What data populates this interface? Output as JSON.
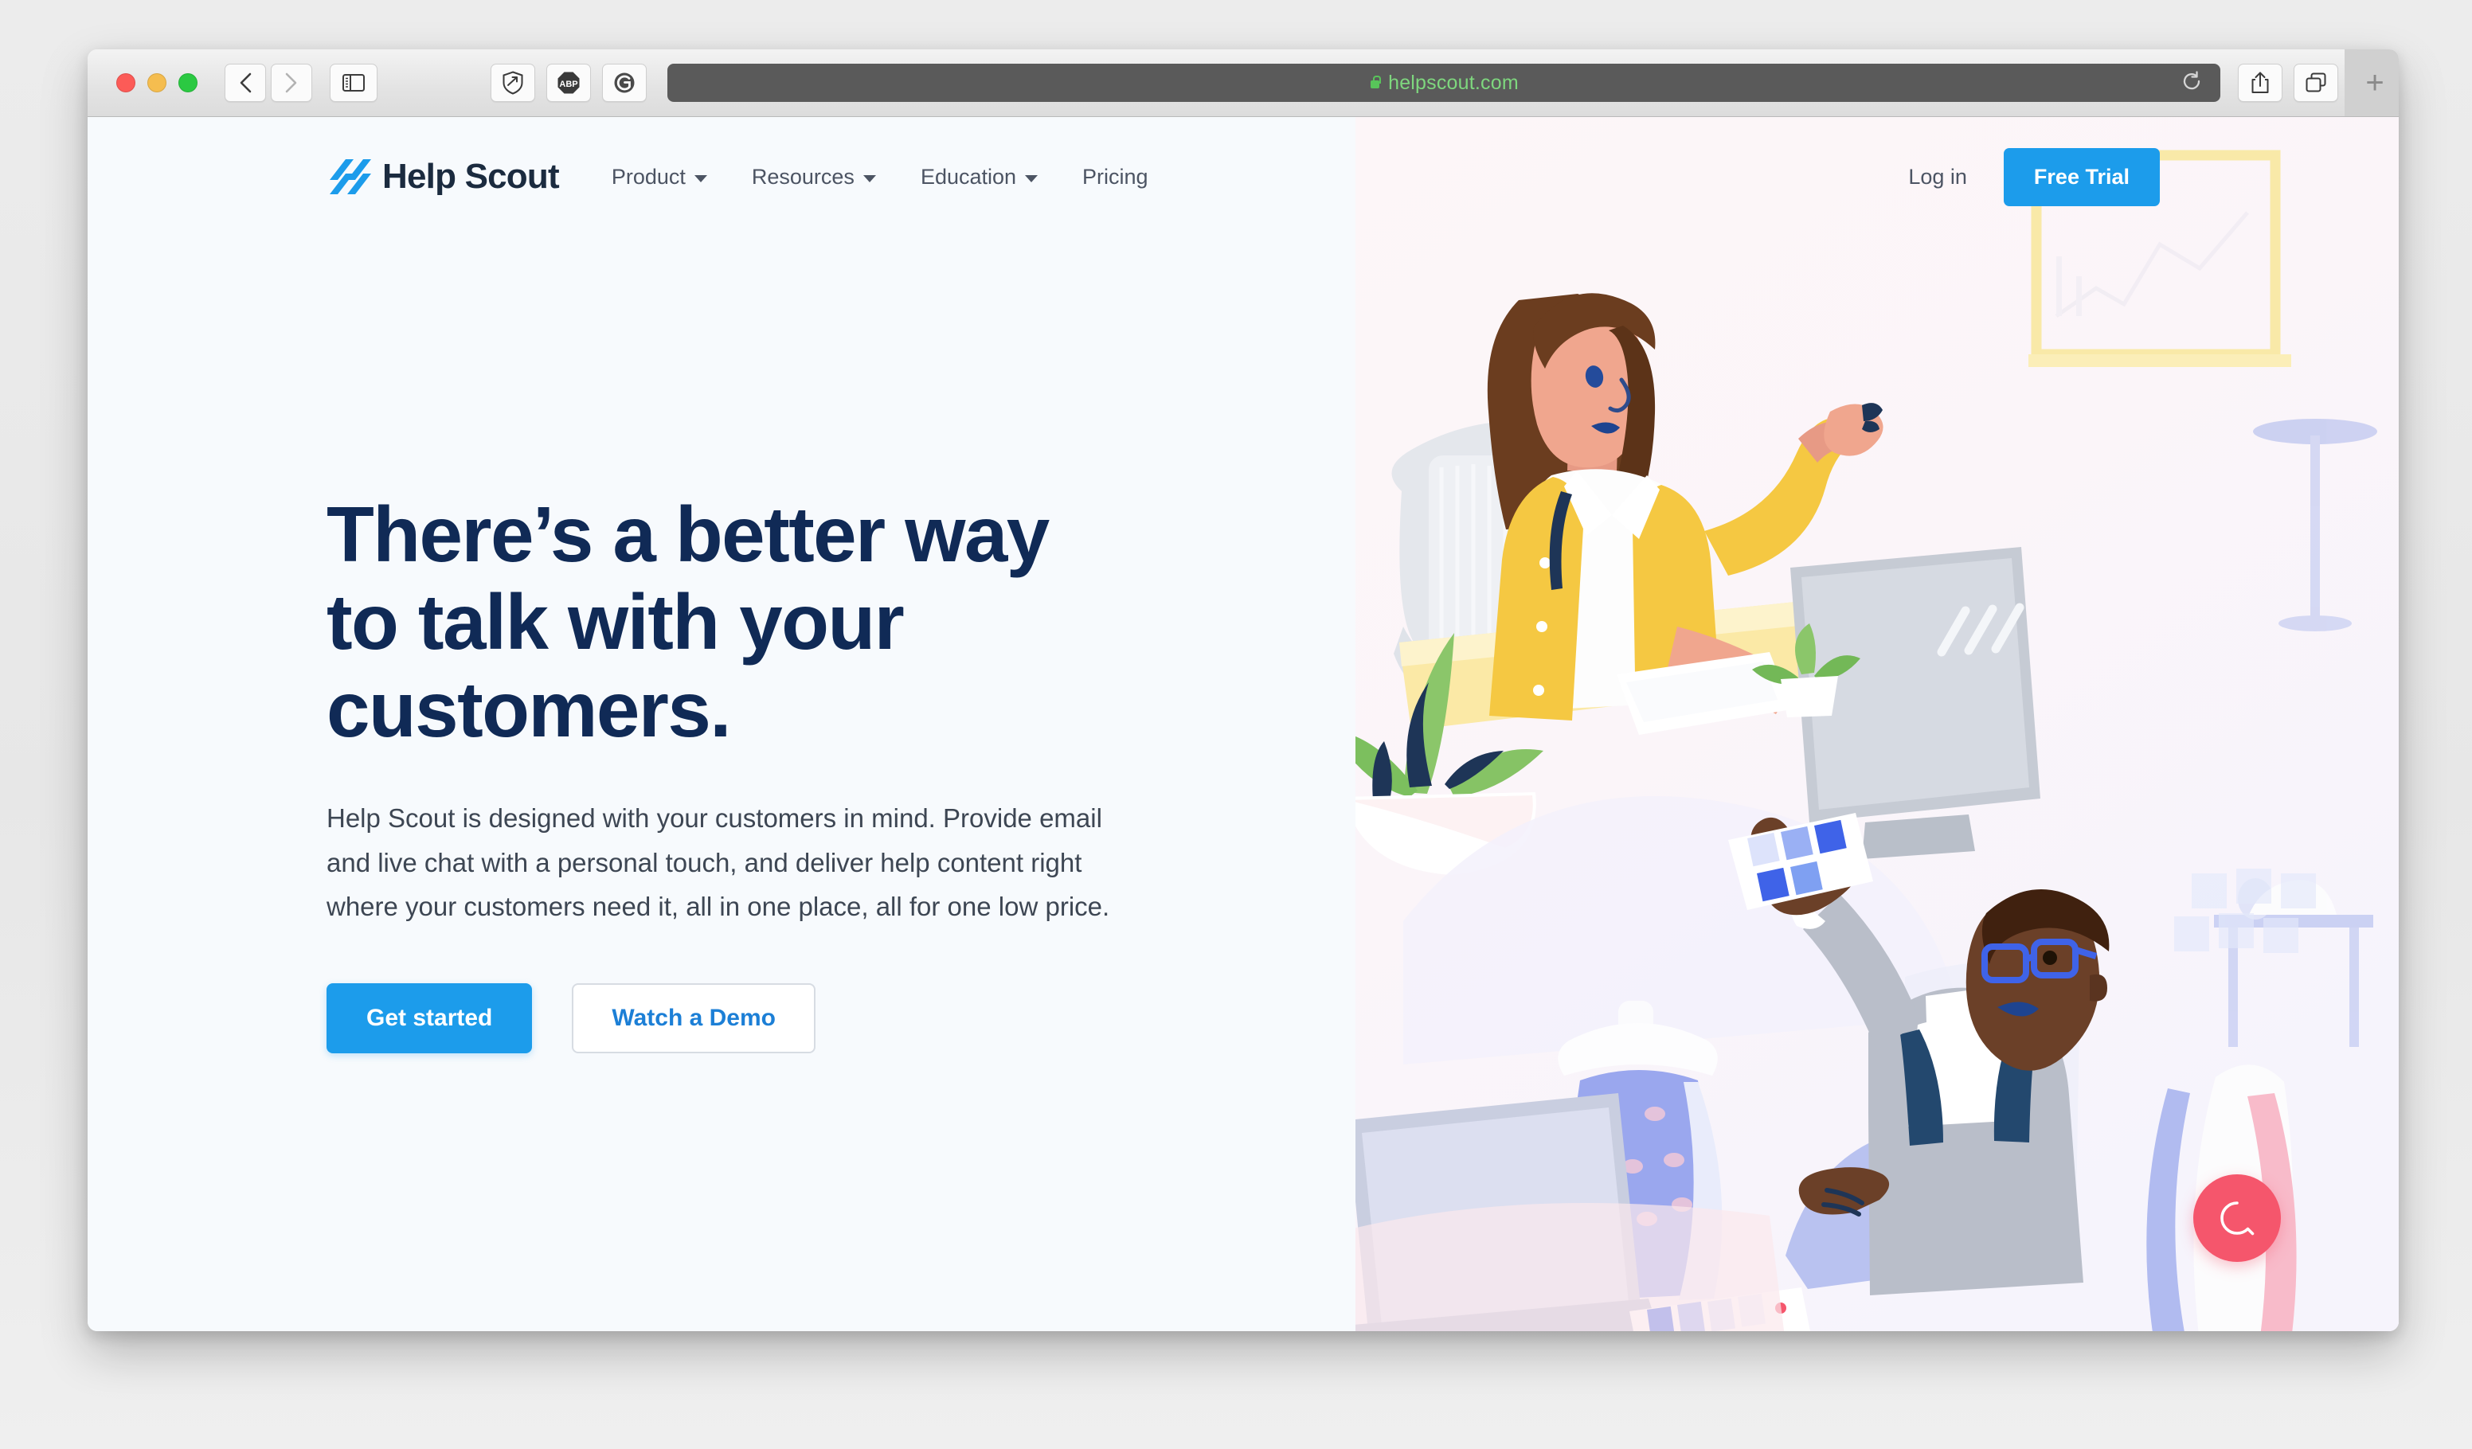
{
  "browser": {
    "name": "Safari",
    "traffic_lights": [
      "close",
      "minimize",
      "zoom"
    ],
    "back_label": "‹",
    "forward_label": "›",
    "sidebar_icon": "sidebar-icon",
    "extensions": [
      {
        "name": "privacy-shield-extension",
        "icon": "shield-icon",
        "label": ""
      },
      {
        "name": "adblock-plus-extension",
        "icon": "abp-icon",
        "label": "ABP"
      },
      {
        "name": "ghostery-extension",
        "icon": "ghostery-g-icon",
        "label": "G"
      }
    ],
    "url": "helpscout.com",
    "url_secure": true,
    "reload_icon": "reload-icon",
    "share_icon": "share-icon",
    "tabs_icon": "tab-overview-icon",
    "new_tab_label": "+"
  },
  "site": {
    "logo_text": "Help Scout",
    "nav": [
      {
        "label": "Product",
        "has_menu": true
      },
      {
        "label": "Resources",
        "has_menu": true
      },
      {
        "label": "Education",
        "has_menu": true
      },
      {
        "label": "Pricing",
        "has_menu": false
      }
    ],
    "login_label": "Log in",
    "free_trial_label": "Free Trial"
  },
  "hero": {
    "headline_line1": "There’s a better way",
    "headline_line2": "to talk with your",
    "headline_line3": "customers.",
    "subcopy": "Help Scout is designed with your customers in mind. Provide email and live chat with a personal touch, and deliver help content right where your customers need it, all in one place, all for one low price.",
    "primary_cta": "Get started",
    "secondary_cta": "Watch a Demo",
    "illustration_alt": "Two support agents at desks in a design studio"
  },
  "widget": {
    "chat_icon": "chat-bubble-icon",
    "chat_label": "Open chat"
  },
  "colors": {
    "brand_blue": "#1c9ceb",
    "headline_navy": "#102a56",
    "page_bg": "#f7fafd",
    "chat_pink": "#f5566c",
    "url_green": "#7ed77e"
  }
}
